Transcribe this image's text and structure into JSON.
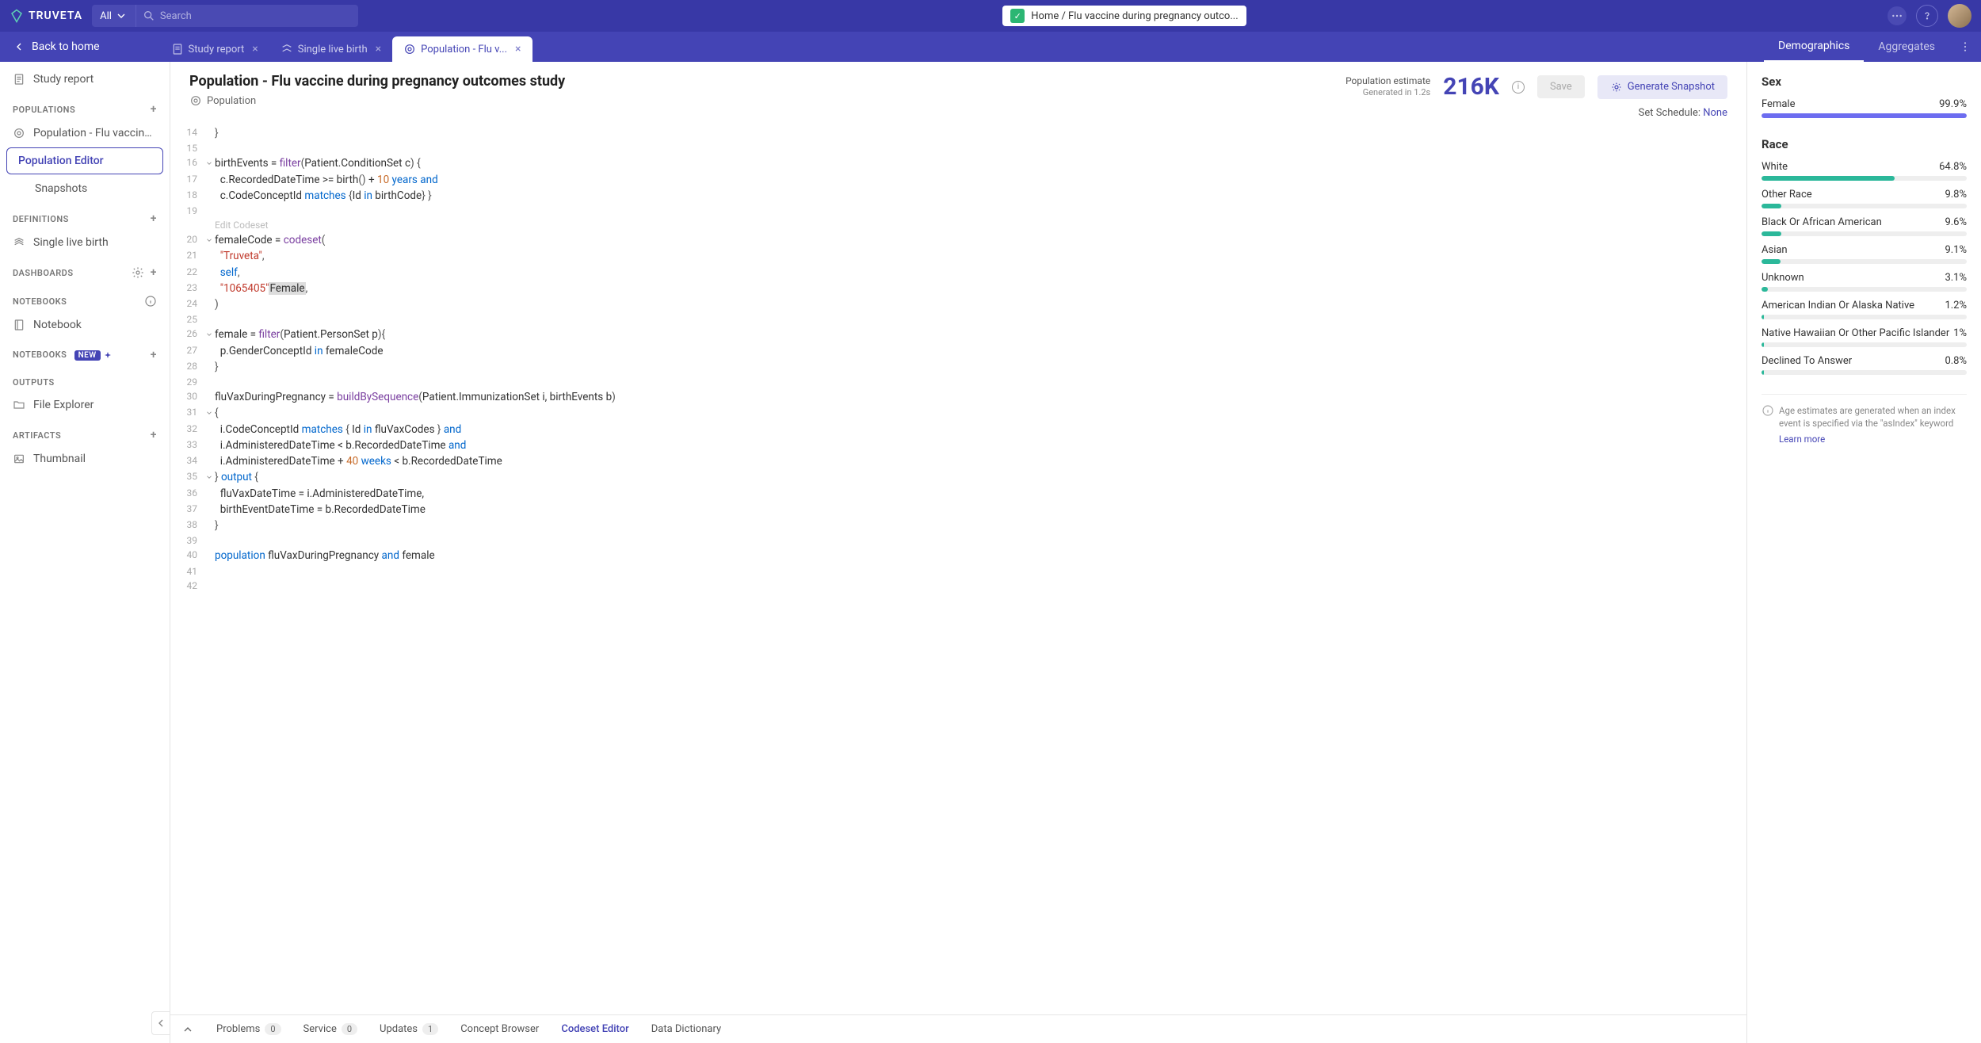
{
  "brand": "TRUVETA",
  "search": {
    "scope": "All",
    "placeholder": "Search"
  },
  "breadcrumb": "Home / Flu vaccine during pregnancy outco...",
  "back_label": "Back to home",
  "tabs": [
    {
      "label": "Study report",
      "closable": true,
      "active": false
    },
    {
      "label": "Single live birth",
      "closable": true,
      "active": false
    },
    {
      "label": "Population - Flu v...",
      "closable": true,
      "active": true
    }
  ],
  "right_tabs": {
    "demographics": "Demographics",
    "aggregates": "Aggregates"
  },
  "sidebar": {
    "study_report": "Study report",
    "sections": {
      "populations": "POPULATIONS",
      "definitions": "DEFINITIONS",
      "dashboards": "DASHBOARDS",
      "notebooks": "NOTEBOOKS",
      "notebooks2": "NOTEBOOKS",
      "outputs": "OUTPUTS",
      "artifacts": "ARTIFACTS"
    },
    "items": {
      "pop_flu": "Population - Flu vaccine ...",
      "pop_editor": "Population Editor",
      "snapshots": "Snapshots",
      "single_live": "Single live birth",
      "notebook": "Notebook",
      "new_badge": "NEW",
      "file_explorer": "File Explorer",
      "thumbnail": "Thumbnail"
    }
  },
  "header": {
    "title": "Population - Flu vaccine during pregnancy outcomes study",
    "subtitle": "Population",
    "pop_est_label": "Population estimate",
    "gen_time": "Generated in 1.2s",
    "pop_number": "216K",
    "save": "Save",
    "generate": "Generate Snapshot",
    "schedule_label": "Set Schedule:",
    "schedule_value": "None"
  },
  "code": {
    "edit_codeset": "Edit Codeset",
    "lines": [
      {
        "n": 14,
        "fold": "",
        "tokens": [
          [
            "op",
            "}"
          ]
        ]
      },
      {
        "n": 15,
        "fold": "",
        "tokens": []
      },
      {
        "n": 16,
        "fold": "v",
        "tokens": [
          [
            "id",
            "birthEvents = "
          ],
          [
            "fn",
            "filter"
          ],
          [
            "op",
            "("
          ],
          [
            "id",
            "Patient.ConditionSet c"
          ],
          [
            "op",
            ") {"
          ]
        ]
      },
      {
        "n": 17,
        "fold": "",
        "tokens": [
          [
            "id",
            "  c.RecordedDateTime >= birth"
          ],
          [
            "op",
            "()"
          ],
          [
            "id",
            " + "
          ],
          [
            "num",
            "10"
          ],
          [
            "id",
            " "
          ],
          [
            "kw",
            "years"
          ],
          [
            "id",
            " "
          ],
          [
            "kw",
            "and"
          ]
        ]
      },
      {
        "n": 18,
        "fold": "",
        "tokens": [
          [
            "id",
            "  c.CodeConceptId "
          ],
          [
            "kw",
            "matches"
          ],
          [
            "id",
            " "
          ],
          [
            "op",
            "{"
          ],
          [
            "id",
            "Id "
          ],
          [
            "kw",
            "in"
          ],
          [
            "id",
            " birthCode"
          ],
          [
            "op",
            "} }"
          ]
        ]
      },
      {
        "n": 19,
        "fold": "",
        "tokens": []
      },
      {
        "n": 20,
        "fold": "v",
        "tokens": [
          [
            "id",
            "femaleCode = "
          ],
          [
            "fn",
            "codeset"
          ],
          [
            "op",
            "("
          ]
        ]
      },
      {
        "n": 21,
        "fold": "",
        "tokens": [
          [
            "id",
            "  "
          ],
          [
            "str",
            "\"Truveta\""
          ],
          [
            "op",
            ","
          ]
        ]
      },
      {
        "n": 22,
        "fold": "",
        "tokens": [
          [
            "id",
            "  "
          ],
          [
            "kw",
            "self"
          ],
          [
            "op",
            ","
          ]
        ]
      },
      {
        "n": 23,
        "fold": "",
        "tokens": [
          [
            "id",
            "  "
          ],
          [
            "str",
            "\"1065405\""
          ],
          [
            "hl",
            "Female"
          ],
          [
            "op",
            ","
          ]
        ]
      },
      {
        "n": 24,
        "fold": "",
        "tokens": [
          [
            "op",
            ")"
          ]
        ]
      },
      {
        "n": 25,
        "fold": "",
        "tokens": []
      },
      {
        "n": 26,
        "fold": "v",
        "tokens": [
          [
            "id",
            "female = "
          ],
          [
            "fn",
            "filter"
          ],
          [
            "op",
            "("
          ],
          [
            "id",
            "Patient.PersonSet p"
          ],
          [
            "op",
            "){"
          ]
        ]
      },
      {
        "n": 27,
        "fold": "",
        "tokens": [
          [
            "id",
            "  p.GenderConceptId "
          ],
          [
            "kw",
            "in"
          ],
          [
            "id",
            " femaleCode"
          ]
        ]
      },
      {
        "n": 28,
        "fold": "",
        "tokens": [
          [
            "op",
            "}"
          ]
        ]
      },
      {
        "n": 29,
        "fold": "",
        "tokens": []
      },
      {
        "n": 30,
        "fold": "",
        "tokens": [
          [
            "id",
            "fluVaxDuringPregnancy = "
          ],
          [
            "fn",
            "buildBySequence"
          ],
          [
            "op",
            "("
          ],
          [
            "id",
            "Patient.ImmunizationSet i, birthEvents b"
          ],
          [
            "op",
            ")"
          ]
        ]
      },
      {
        "n": 31,
        "fold": "v",
        "tokens": [
          [
            "op",
            "{"
          ]
        ]
      },
      {
        "n": 32,
        "fold": "",
        "tokens": [
          [
            "id",
            "  i.CodeConceptId "
          ],
          [
            "kw",
            "matches"
          ],
          [
            "id",
            " "
          ],
          [
            "op",
            "{"
          ],
          [
            "id",
            " Id "
          ],
          [
            "kw",
            "in"
          ],
          [
            "id",
            " fluVaxCodes "
          ],
          [
            "op",
            "}"
          ],
          [
            "id",
            " "
          ],
          [
            "kw",
            "and"
          ]
        ]
      },
      {
        "n": 33,
        "fold": "",
        "tokens": [
          [
            "id",
            "  i.AdministeredDateTime < b.RecordedDateTime "
          ],
          [
            "kw",
            "and"
          ]
        ]
      },
      {
        "n": 34,
        "fold": "",
        "tokens": [
          [
            "id",
            "  i.AdministeredDateTime + "
          ],
          [
            "num",
            "40"
          ],
          [
            "id",
            " "
          ],
          [
            "kw",
            "weeks"
          ],
          [
            "id",
            " < b.RecordedDateTime"
          ]
        ]
      },
      {
        "n": 35,
        "fold": "v",
        "tokens": [
          [
            "op",
            "}"
          ],
          [
            "id",
            " "
          ],
          [
            "kw",
            "output"
          ],
          [
            "id",
            " "
          ],
          [
            "op",
            "{"
          ]
        ]
      },
      {
        "n": 36,
        "fold": "",
        "tokens": [
          [
            "id",
            "  fluVaxDateTime = i.AdministeredDateTime,"
          ]
        ]
      },
      {
        "n": 37,
        "fold": "",
        "tokens": [
          [
            "id",
            "  birthEventDateTime = b.RecordedDateTime"
          ]
        ]
      },
      {
        "n": 38,
        "fold": "",
        "tokens": [
          [
            "op",
            "}"
          ]
        ]
      },
      {
        "n": 39,
        "fold": "",
        "tokens": []
      },
      {
        "n": 40,
        "fold": "",
        "tokens": [
          [
            "kw",
            "population"
          ],
          [
            "id",
            " fluVaxDuringPregnancy "
          ],
          [
            "kw",
            "and"
          ],
          [
            "id",
            " female"
          ]
        ]
      },
      {
        "n": 41,
        "fold": "",
        "tokens": []
      },
      {
        "n": 42,
        "fold": "",
        "tokens": []
      }
    ]
  },
  "bottom": {
    "problems": "Problems",
    "problems_n": "0",
    "service": "Service",
    "service_n": "0",
    "updates": "Updates",
    "updates_n": "1",
    "concept": "Concept Browser",
    "codeset": "Codeset Editor",
    "dict": "Data Dictionary"
  },
  "demographics": {
    "sex": {
      "title": "Sex",
      "rows": [
        {
          "label": "Female",
          "pct": 99.9,
          "color": "#6d6df0"
        }
      ]
    },
    "race": {
      "title": "Race",
      "rows": [
        {
          "label": "White",
          "pct": 64.8,
          "color": "#2bb89a"
        },
        {
          "label": "Other Race",
          "pct": 9.8,
          "color": "#2bb89a"
        },
        {
          "label": "Black Or African American",
          "pct": 9.6,
          "color": "#2bb89a"
        },
        {
          "label": "Asian",
          "pct": 9.1,
          "color": "#2bb89a"
        },
        {
          "label": "Unknown",
          "pct": 3.1,
          "color": "#2bb89a"
        },
        {
          "label": "American Indian Or Alaska Native",
          "pct": 1.2,
          "color": "#2bb89a"
        },
        {
          "label": "Native Hawaiian Or Other Pacific Islander",
          "pct": 1.0,
          "color": "#2bb89a"
        },
        {
          "label": "Declined To Answer",
          "pct": 0.8,
          "color": "#2bb89a"
        }
      ]
    },
    "note": "Age estimates are generated when an index event is specified via the \"asIndex\" keyword",
    "learn_more": "Learn more"
  },
  "chart_data": [
    {
      "type": "bar",
      "title": "Sex",
      "orientation": "horizontal",
      "unit": "%",
      "categories": [
        "Female"
      ],
      "values": [
        99.9
      ]
    },
    {
      "type": "bar",
      "title": "Race",
      "orientation": "horizontal",
      "unit": "%",
      "categories": [
        "White",
        "Other Race",
        "Black Or African American",
        "Asian",
        "Unknown",
        "American Indian Or Alaska Native",
        "Native Hawaiian Or Other Pacific Islander",
        "Declined To Answer"
      ],
      "values": [
        64.8,
        9.8,
        9.6,
        9.1,
        3.1,
        1.2,
        1.0,
        0.8
      ]
    }
  ]
}
